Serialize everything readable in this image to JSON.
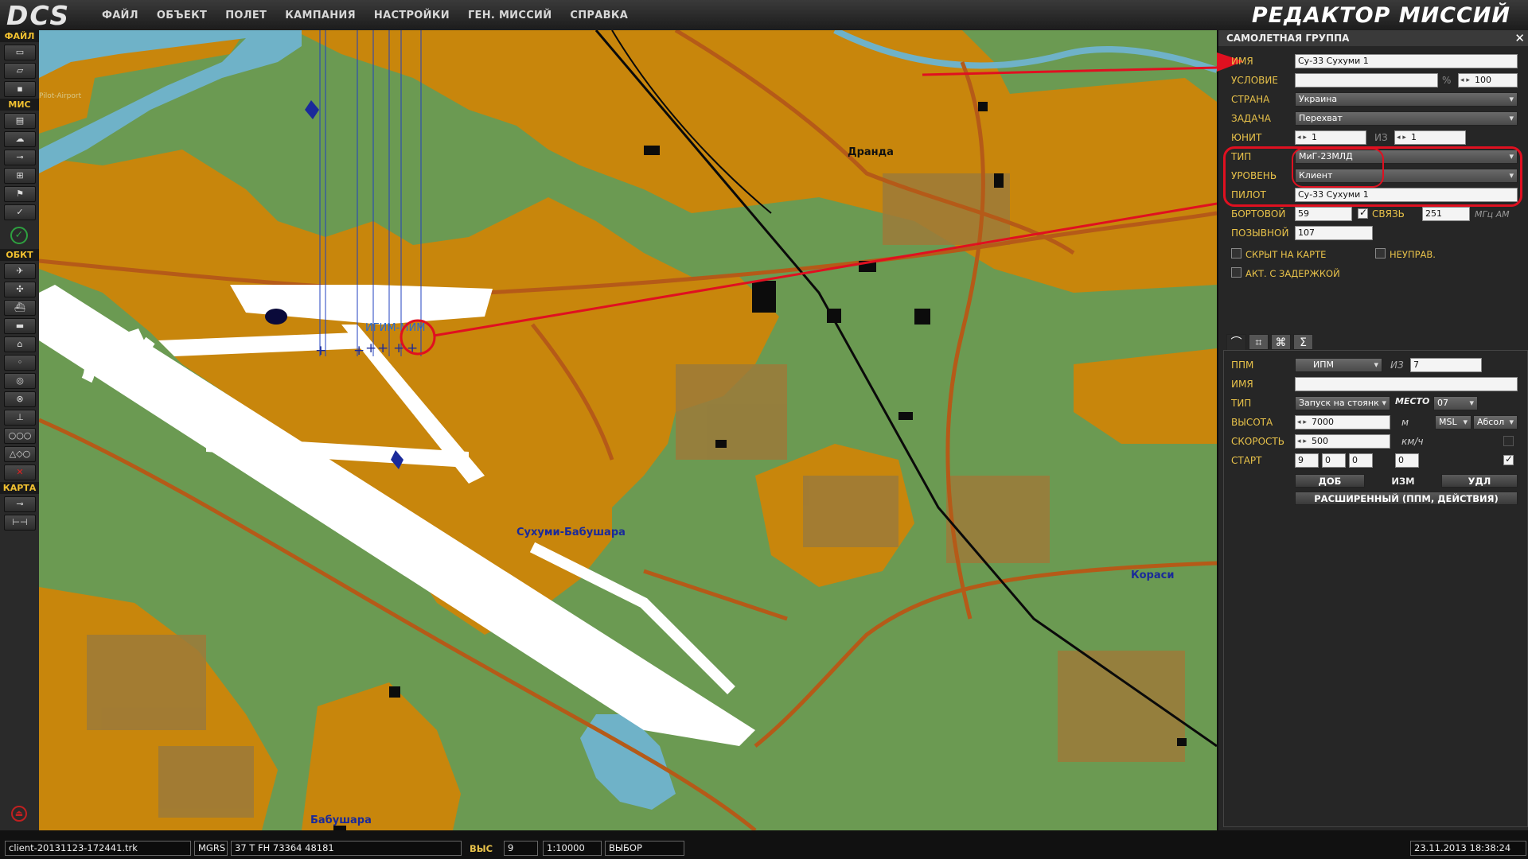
{
  "app": {
    "logo_text": "DCS",
    "title": "РЕДАКТОР МИССИЙ"
  },
  "menu": [
    "ФАЙЛ",
    "ОБЪЕКТ",
    "ПОЛЕТ",
    "КАМПАНИЯ",
    "НАСТРОЙКИ",
    "ГЕН. МИССИЙ",
    "СПРАВКА"
  ],
  "toolbar": {
    "sections": [
      "ФАЙЛ",
      "МИС",
      "ОБКТ",
      "КАРТА"
    ],
    "file_tools": [
      "new-file-icon",
      "open-folder-icon",
      "save-icon"
    ],
    "mission_tools": [
      "briefing-icon",
      "weather-icon",
      "trigger-icon",
      "resource-icon",
      "goals-icon",
      "check-icon"
    ],
    "object_tools": [
      "plane-icon",
      "helicopter-icon",
      "ship-icon",
      "vehicle-icon",
      "static-icon",
      "waypoint-icon",
      "zone-icon",
      "nav-target-icon",
      "airfield-icon",
      "group-icon",
      "shapes-icon",
      "delete-icon"
    ],
    "map_tools": [
      "map-options-icon",
      "ruler-icon"
    ]
  },
  "map": {
    "labels": {
      "city1": "Дранда",
      "city2": "Кораси",
      "city3": "Бабушара",
      "airfield": "Сухуми-Бабушара",
      "unit_label": "ИГИМ-МИМ",
      "old_label": "Pilot-Airport"
    },
    "colors": {
      "grass": "#6b9a52",
      "urban": "#c8860c",
      "sea": "#6fb2c8",
      "road": "#b55a18",
      "runway": "#ffffff",
      "rail": "#0a0a0a",
      "unit": "#1a2a9a"
    }
  },
  "panel": {
    "title": "САМОЛЕТНАЯ ГРУППА",
    "name_label": "ИМЯ",
    "name_value": "Су-33 Сухуми  1",
    "condition_label": "УСЛОВИЕ",
    "condition_value": "",
    "percent_sign": "%",
    "probability": "100",
    "country_label": "СТРАНА",
    "country_value": "Украина",
    "task_label": "ЗАДАЧА",
    "task_value": "Перехват",
    "unit_label": "ЮНИТ",
    "unit_value": "1",
    "unit_of_label": "ИЗ",
    "unit_total": "1",
    "type_label": "ТИП",
    "type_value": "МиГ-23МЛД",
    "skill_label": "УРОВЕНЬ",
    "skill_value": "Клиент",
    "pilot_label": "ПИЛОТ",
    "pilot_value": "Су-33 Сухуми  1",
    "board_label": "БОРТОВОЙ",
    "board_value": "59",
    "radio_label": "СВЯЗЬ",
    "radio_value": "251",
    "radio_unit": "МГц АМ",
    "callsign_label": "ПОЗЫВНОЙ",
    "callsign_value": "107",
    "hidden_label": "СКРЫТ НА КАРТЕ",
    "uncontrolled_label": "НЕУПРАВ.",
    "delayed_label": "АКТ. С ЗАДЕРЖКОЙ",
    "tabs": [
      "route-tab-icon",
      "payload-tab-icon",
      "properties-tab-icon",
      "summary-tab-icon"
    ],
    "wp_label": "ППМ",
    "wp_value": "ИПМ",
    "wp_of_label": "ИЗ",
    "wp_total": "7",
    "wp_name_label": "ИМЯ",
    "wp_name_value": "",
    "wp_type_label": "ТИП",
    "wp_type_value": "Запуск на стоянк",
    "place_label": "МЕСТО",
    "place_value": "07",
    "alt_label": "ВЫСОТА",
    "alt_value": "7000",
    "alt_unit": "м",
    "alt_mode": "MSL",
    "alt_ref": "Абсол",
    "speed_label": "СКОРОСТЬ",
    "speed_value": "500",
    "speed_unit": "км/ч",
    "start_label": "СТАРТ",
    "start_d": "9",
    "start_h": "0",
    "start_m": "0",
    "start_s": "0",
    "add_btn": "ДОБ",
    "edit_btn": "ИЗМ",
    "del_btn": "УДЛ",
    "advanced_btn": "РАСШИРЕННЫЙ (ППМ, ДЕЙСТВИЯ)"
  },
  "status": {
    "file": "client-20131123-172441.trk",
    "coord_mode": "MGRS",
    "coord": "37  T  FH  73364  48181",
    "alt_label": "ВЫС",
    "alt": "9",
    "scale": "1:10000",
    "mode": "ВЫБОР",
    "datetime": "23.11.2013 18:38:24"
  }
}
